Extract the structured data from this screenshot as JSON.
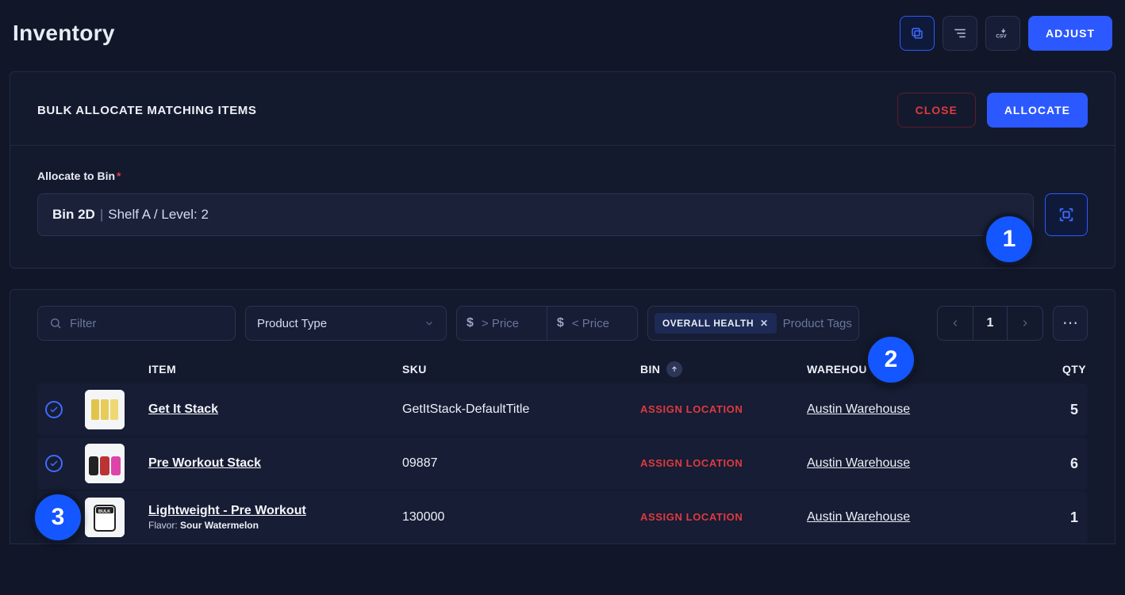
{
  "header": {
    "title": "Inventory",
    "adjust_label": "ADJUST"
  },
  "bulk": {
    "title": "BULK ALLOCATE MATCHING ITEMS",
    "close_label": "CLOSE",
    "allocate_label": "ALLOCATE",
    "bin_label": "Allocate to Bin",
    "required_mark": "*",
    "selected_bin_name": "Bin 2D",
    "selected_bin_path": "Shelf A / Level: 2",
    "pipe": "|"
  },
  "filters": {
    "filter_placeholder": "Filter",
    "product_type_label": "Product Type",
    "price_min_placeholder": "> Price",
    "price_max_placeholder": "< Price",
    "tag_label": "OVERALL HEALTH",
    "tag_x": "✕",
    "tags_placeholder": "Product Tags",
    "page_number": "1",
    "more_label": "⋯"
  },
  "columns": {
    "item": "ITEM",
    "sku": "SKU",
    "bin": "BIN",
    "warehouse": "WAREHOUSE",
    "qty": "QTY"
  },
  "rows": [
    {
      "name": "Get It Stack",
      "sku": "GetItStack-DefaultTitle",
      "bin": "ASSIGN LOCATION",
      "warehouse": "Austin Warehouse",
      "qty": "5",
      "sub_label": "",
      "sub_value": ""
    },
    {
      "name": "Pre Workout Stack",
      "sku": "09887",
      "bin": "ASSIGN LOCATION",
      "warehouse": "Austin Warehouse",
      "qty": "6",
      "sub_label": "",
      "sub_value": ""
    },
    {
      "name": "Lightweight - Pre Workout",
      "sku": "130000",
      "bin": "ASSIGN LOCATION",
      "warehouse": "Austin Warehouse",
      "qty": "1",
      "sub_label": "Flavor:",
      "sub_value": "Sour Watermelon"
    }
  ],
  "callouts": {
    "one": "1",
    "two": "2",
    "three": "3"
  }
}
